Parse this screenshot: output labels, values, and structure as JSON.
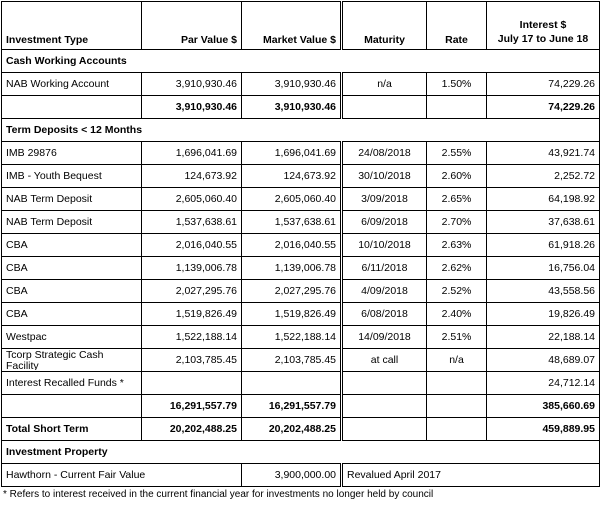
{
  "header": {
    "investment_type": "Investment Type",
    "par_value": "Par Value $",
    "market_value": "Market Value $",
    "maturity": "Maturity",
    "rate": "Rate",
    "interest_line1": "Interest $",
    "interest_line2": "July 17 to June 18"
  },
  "cash_section": {
    "title": "Cash Working Accounts",
    "rows": [
      {
        "type": "NAB Working Account",
        "par": "3,910,930.46",
        "market": "3,910,930.46",
        "maturity": "n/a",
        "rate": "1.50%",
        "interest": "74,229.26"
      }
    ],
    "subtotal": {
      "par": "3,910,930.46",
      "market": "3,910,930.46",
      "interest": "74,229.26"
    }
  },
  "term_section": {
    "title": "Term Deposits < 12 Months",
    "rows": [
      {
        "type": "IMB 29876",
        "par": "1,696,041.69",
        "market": "1,696,041.69",
        "maturity": "24/08/2018",
        "rate": "2.55%",
        "interest": "43,921.74"
      },
      {
        "type": "IMB - Youth Bequest",
        "par": "124,673.92",
        "market": "124,673.92",
        "maturity": "30/10/2018",
        "rate": "2.60%",
        "interest": "2,252.72"
      },
      {
        "type": "NAB Term Deposit",
        "par": "2,605,060.40",
        "market": "2,605,060.40",
        "maturity": "3/09/2018",
        "rate": "2.65%",
        "interest": "64,198.92"
      },
      {
        "type": "NAB Term Deposit",
        "par": "1,537,638.61",
        "market": "1,537,638.61",
        "maturity": "6/09/2018",
        "rate": "2.70%",
        "interest": "37,638.61"
      },
      {
        "type": "CBA",
        "par": "2,016,040.55",
        "market": "2,016,040.55",
        "maturity": "10/10/2018",
        "rate": "2.63%",
        "interest": "61,918.26"
      },
      {
        "type": "CBA",
        "par": "1,139,006.78",
        "market": "1,139,006.78",
        "maturity": "6/11/2018",
        "rate": "2.62%",
        "interest": "16,756.04"
      },
      {
        "type": "CBA",
        "par": "2,027,295.76",
        "market": "2,027,295.76",
        "maturity": "4/09/2018",
        "rate": "2.52%",
        "interest": "43,558.56"
      },
      {
        "type": "CBA",
        "par": "1,519,826.49",
        "market": "1,519,826.49",
        "maturity": "6/08/2018",
        "rate": "2.40%",
        "interest": "19,826.49"
      },
      {
        "type": "Westpac",
        "par": "1,522,188.14",
        "market": "1,522,188.14",
        "maturity": "14/09/2018",
        "rate": "2.51%",
        "interest": "22,188.14"
      },
      {
        "type": "Tcorp Strategic Cash Facility",
        "par": "2,103,785.45",
        "market": "2,103,785.45",
        "maturity": "at call",
        "rate": "n/a",
        "interest": "48,689.07"
      },
      {
        "type": "Interest Recalled Funds *",
        "par": "",
        "market": "",
        "maturity": "",
        "rate": "",
        "interest": "24,712.14"
      }
    ],
    "subtotal": {
      "par": "16,291,557.79",
      "market": "16,291,557.79",
      "interest": "385,660.69"
    }
  },
  "total_short_term": {
    "label": "Total Short Term",
    "par": "20,202,488.25",
    "market": "20,202,488.25",
    "interest": "459,889.95"
  },
  "property_section": {
    "title": "Investment Property",
    "row": {
      "type": "Hawthorn - Current Fair Value",
      "market": "3,900,000.00",
      "note": "Revalued April 2017"
    }
  },
  "footnote": "* Refers to interest received in the current financial year for investments no longer held by council"
}
